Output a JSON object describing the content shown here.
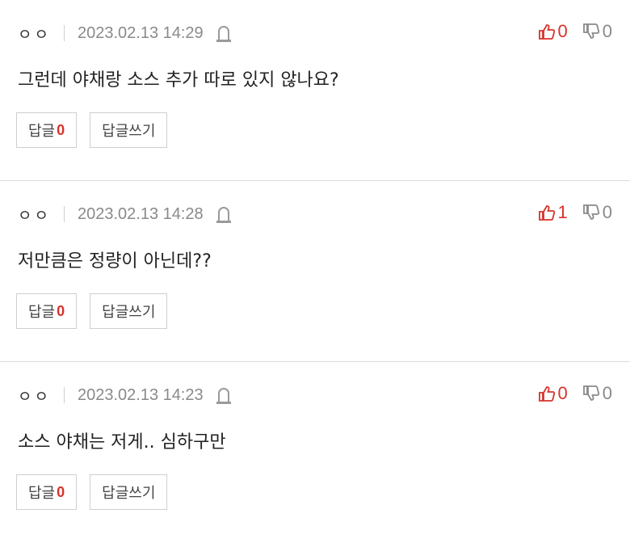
{
  "colors": {
    "accent": "#d8332b",
    "muted": "#8a8a8a",
    "border": "#cfcfcf"
  },
  "comments": [
    {
      "author": "ㅇㅇ",
      "date": "2023.02.13 14:29",
      "likes": "0",
      "dislikes": "0",
      "text": "그런데 야채랑 소스 추가 따로 있지 않나요?",
      "reply_label": "답글",
      "reply_count": "0",
      "write_reply_label": "답글쓰기"
    },
    {
      "author": "ㅇㅇ",
      "date": "2023.02.13 14:28",
      "likes": "1",
      "dislikes": "0",
      "text": "저만큼은 정량이 아닌데??",
      "reply_label": "답글",
      "reply_count": "0",
      "write_reply_label": "답글쓰기"
    },
    {
      "author": "ㅇㅇ",
      "date": "2023.02.13 14:23",
      "likes": "0",
      "dislikes": "0",
      "text": "소스 야채는 저게.. 심하구만",
      "reply_label": "답글",
      "reply_count": "0",
      "write_reply_label": "답글쓰기"
    }
  ],
  "icons": {
    "report": "siren-icon",
    "like": "thumbs-up-icon",
    "dislike": "thumbs-down-icon"
  }
}
